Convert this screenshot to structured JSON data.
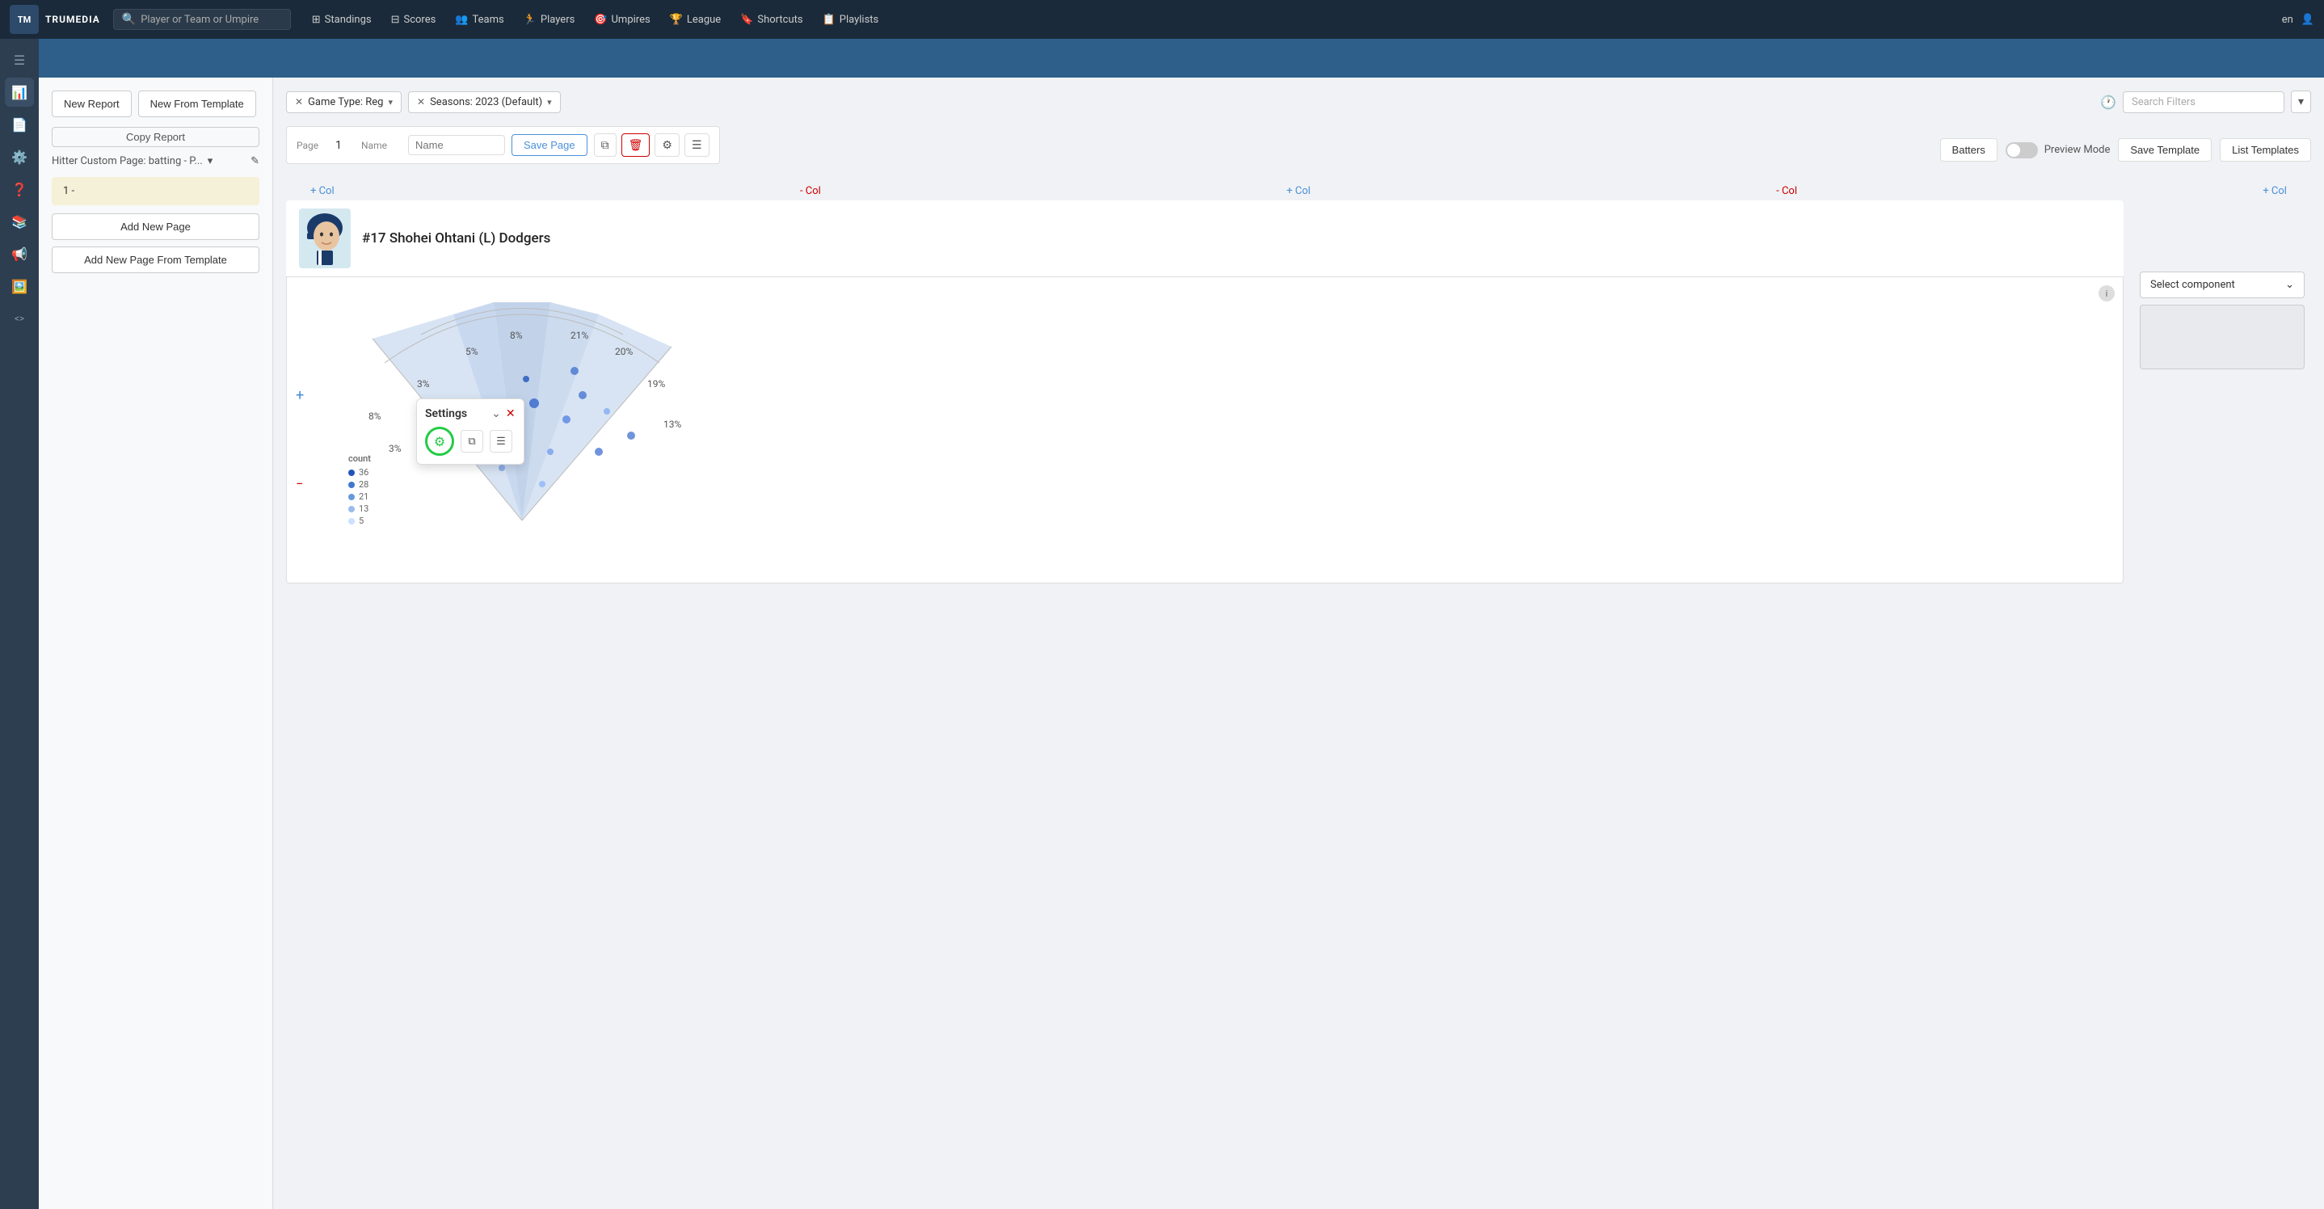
{
  "topnav": {
    "logo_text": "TM",
    "brand": "TRUMEDIA",
    "search_placeholder": "Player or Team or Umpire",
    "nav_items": [
      {
        "label": "Standings",
        "icon": "⊞"
      },
      {
        "label": "Scores",
        "icon": "⊟"
      },
      {
        "label": "Teams",
        "icon": "👥"
      },
      {
        "label": "Players",
        "icon": "🏃"
      },
      {
        "label": "Umpires",
        "icon": "🎯"
      },
      {
        "label": "League",
        "icon": "🏆"
      },
      {
        "label": "Shortcuts",
        "icon": "🔖"
      },
      {
        "label": "Playlists",
        "icon": "📋"
      }
    ],
    "lang": "en",
    "user_icon": "👤"
  },
  "sidebar": {
    "items": [
      {
        "icon": "☰",
        "name": "menu"
      },
      {
        "icon": "📊",
        "name": "reports"
      },
      {
        "icon": "📄",
        "name": "pages"
      },
      {
        "icon": "⚙️",
        "name": "settings"
      },
      {
        "icon": "❓",
        "name": "help"
      },
      {
        "icon": "📚",
        "name": "library"
      },
      {
        "icon": "📢",
        "name": "broadcast"
      },
      {
        "icon": "🖼️",
        "name": "images"
      },
      {
        "icon": "<>",
        "name": "code"
      }
    ]
  },
  "left_panel": {
    "new_report_label": "New Report",
    "new_from_template_label": "New From Template",
    "copy_report_label": "Copy Report",
    "page_dropdown_label": "Hitter Custom Page: batting - P...",
    "page_item_label": "1 -",
    "add_new_page_label": "Add New Page",
    "add_new_page_template_label": "Add New Page From Template"
  },
  "toolbar": {
    "filter_game_type": "Game Type: Reg",
    "filter_seasons": "Seasons: 2023 (Default)",
    "search_filters_placeholder": "Search Filters",
    "page_label": "Page",
    "name_label": "Name",
    "page_number": "1",
    "name_placeholder": "Name",
    "save_page_label": "Save Page",
    "batters_label": "Batters",
    "preview_mode_label": "Preview Mode",
    "save_template_label": "Save Template",
    "list_templates_label": "List Templates"
  },
  "chart": {
    "player_number": "#17",
    "player_name": "Shohei Ohtani (L) Dodgers",
    "info_icon": "i",
    "percentages": {
      "p3a": "3%",
      "p3b": "3%",
      "p5": "5%",
      "p8a": "8%",
      "p8b": "8%",
      "p13": "13%",
      "p19": "19%",
      "p20": "20%",
      "p21": "21%"
    },
    "legend_label": "count",
    "legend_items": [
      {
        "value": 36,
        "color": "#3366cc"
      },
      {
        "value": 28,
        "color": "#5588dd"
      },
      {
        "value": 21,
        "color": "#88aaee"
      },
      {
        "value": 13,
        "color": "#aaccff"
      },
      {
        "value": 5,
        "color": "#cce0ff"
      }
    ],
    "settings_popup": {
      "title": "Settings",
      "close_icon": "✕",
      "collapse_icon": "⌄",
      "gear_icon": "⚙",
      "copy_icon": "⧉",
      "filter_icon": "☰"
    },
    "col_controls": {
      "add_col": "+ Col",
      "remove_col": "- Col"
    }
  },
  "select_component": {
    "label": "Select component",
    "chevron": "⌄"
  }
}
